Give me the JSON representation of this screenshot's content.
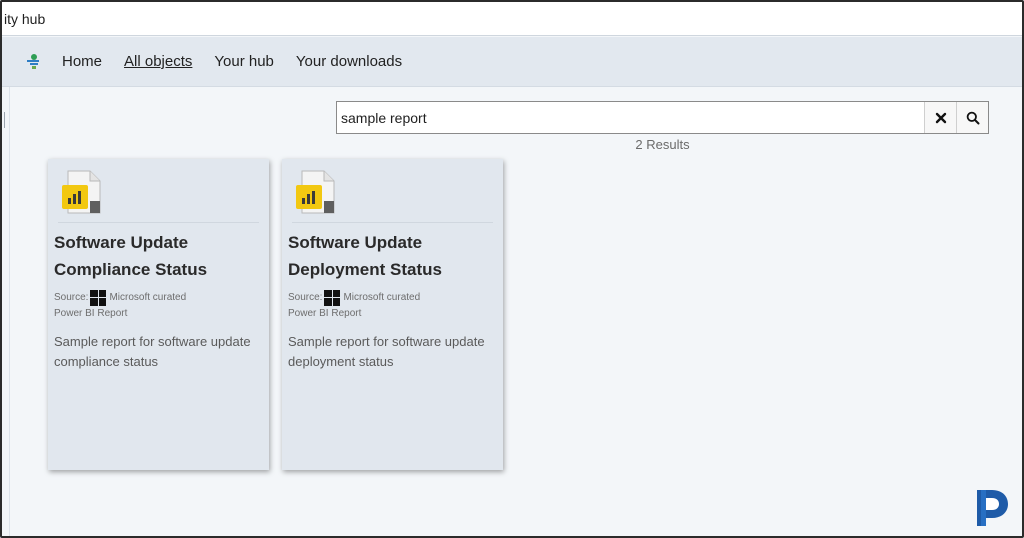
{
  "window": {
    "title": "ity hub"
  },
  "nav": {
    "items": [
      {
        "label": "Home",
        "active": false
      },
      {
        "label": "All objects",
        "active": true
      },
      {
        "label": "Your hub",
        "active": false
      },
      {
        "label": "Your downloads",
        "active": false
      }
    ]
  },
  "search": {
    "value": "sample report",
    "results_text": "2 Results"
  },
  "cards": [
    {
      "title_line1": "Software Update",
      "title_line2": "Compliance Status",
      "source_label": "Source:",
      "source_value": "Microsoft curated",
      "type": "Power BI Report",
      "desc_line1": "Sample report for software update",
      "desc_line2": "compliance status"
    },
    {
      "title_line1": "Software Update",
      "title_line2": "Deployment Status",
      "source_label": "Source:",
      "source_value": "Microsoft curated",
      "type": "Power BI Report",
      "desc_line1": "Sample report for software update",
      "desc_line2": "deployment status"
    }
  ],
  "colors": {
    "accent_yellow": "#f2c811",
    "brand_blue": "#1e5ba8"
  },
  "icons": {
    "clear": "clear-icon",
    "search": "search-icon",
    "report": "power-bi-report-icon",
    "brand": "brand-logo"
  }
}
